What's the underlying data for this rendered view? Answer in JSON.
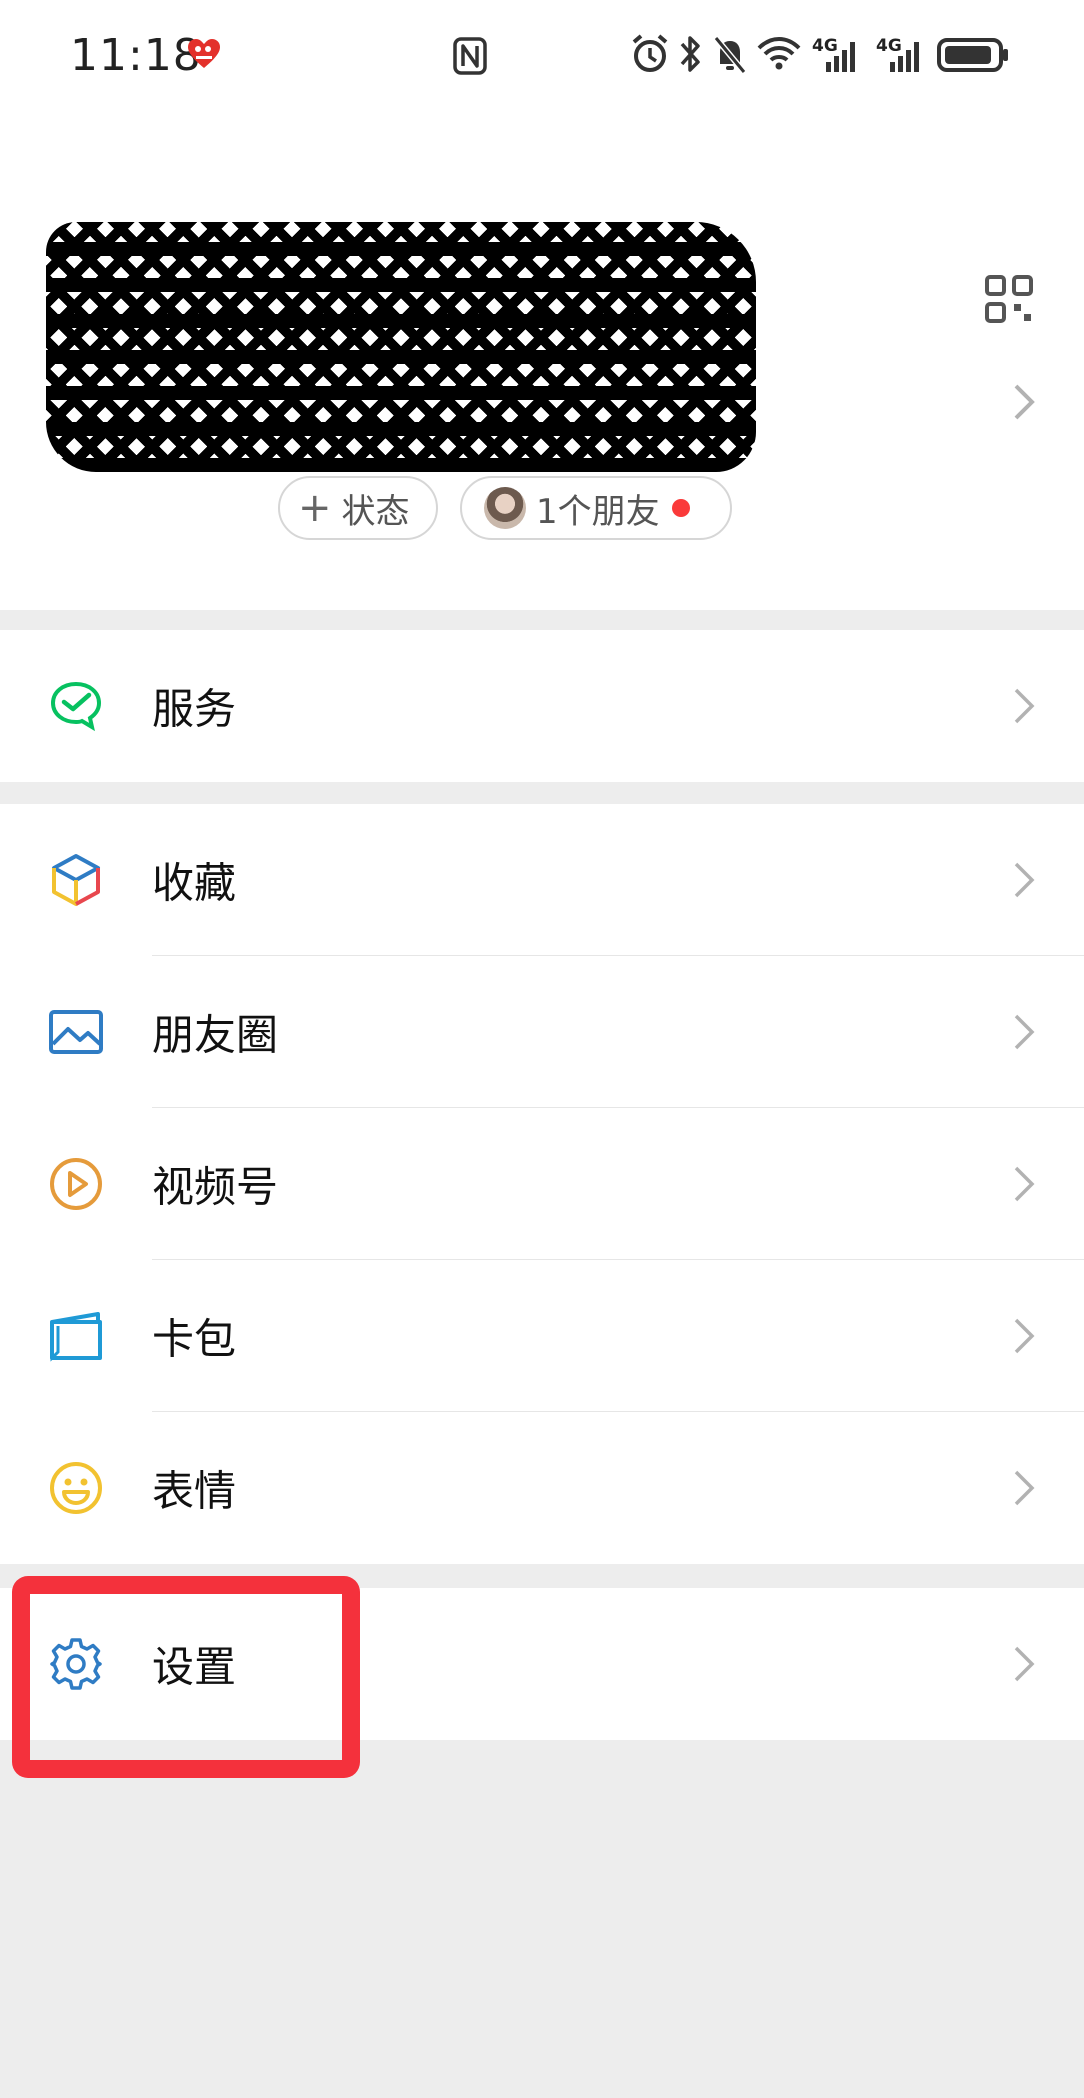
{
  "status_bar": {
    "time": "11:18",
    "network_1": "4G",
    "network_2": "4G"
  },
  "profile": {
    "status_pill": "状态",
    "friends_pill": "1个朋友"
  },
  "menu": {
    "service": "服务",
    "favorites": "收藏",
    "moments": "朋友圈",
    "channels": "视频号",
    "card_wallet": "卡包",
    "stickers": "表情",
    "settings": "设置"
  },
  "colors": {
    "page_bg": "#ededed",
    "service_green": "#07c160",
    "moments_blue": "#2f7cc4",
    "channels_orange": "#e59b3b",
    "wallet_blue": "#1f9ad6",
    "stickers_yellow": "#f2c230",
    "settings_blue": "#2f7cc4",
    "highlight_red": "#f4313c",
    "notification_red": "#fa3a3a"
  },
  "icons": {
    "service": "wechat-pay-check-icon",
    "favorites": "cube-icon",
    "moments": "landscape-photo-icon",
    "channels": "play-circle-icon",
    "card_wallet": "card-wallet-icon",
    "stickers": "smiley-icon",
    "settings": "gear-icon",
    "qr": "qr-code-icon"
  }
}
